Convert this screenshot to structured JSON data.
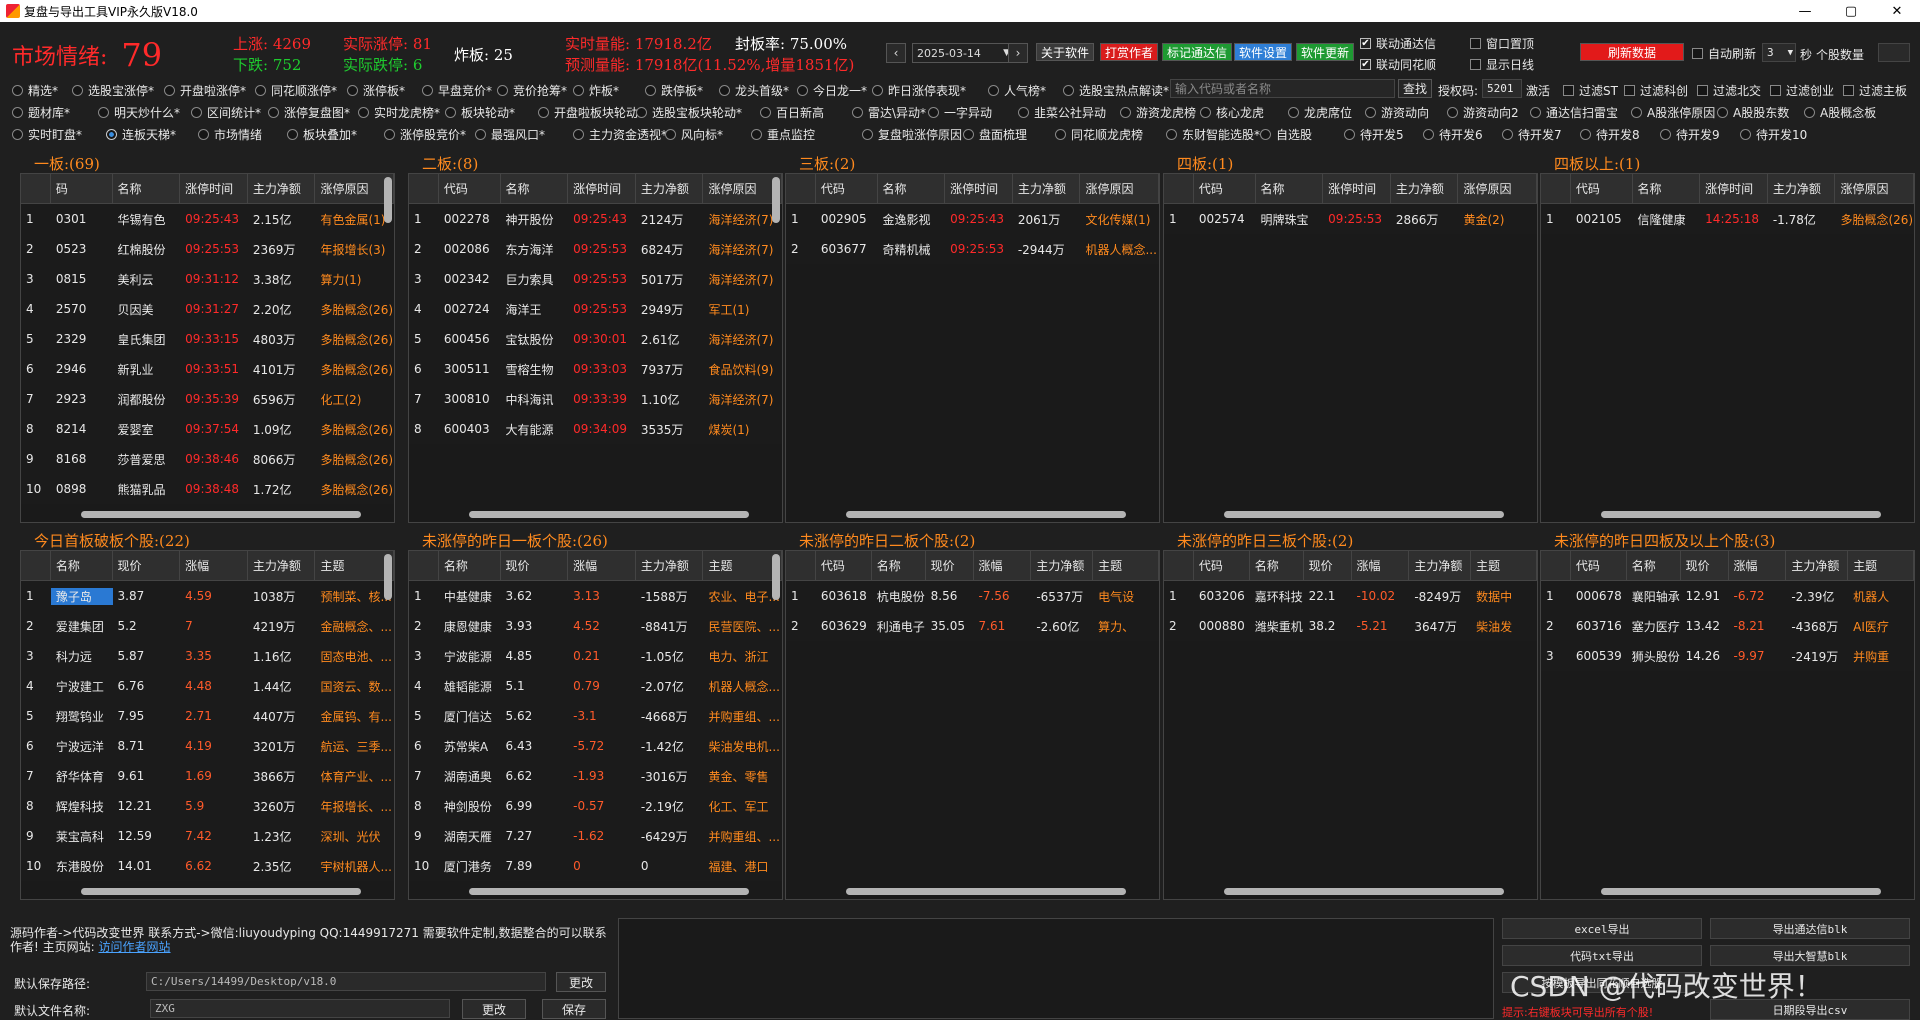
{
  "window": {
    "title": "复盘与导出工具VIP永久版V18.0",
    "min": "—",
    "max": "▢",
    "close": "✕"
  },
  "sentiment": {
    "label": "市场情绪:",
    "value": "79"
  },
  "stats": {
    "up": "上涨: 4269",
    "real_up": "实际涨停: 81",
    "down": "下跌: 752",
    "real_down": "实际跌停: 6",
    "zb": "炸板: 25",
    "vol": "实时量能: 17918.2亿",
    "fbl": "封板率: 75.00%",
    "pred": "预测量能: 17918亿(11.52%,增量1851亿)"
  },
  "toolbar": {
    "date": "2025-03-14",
    "about": "关于软件",
    "tip": "打赏作者",
    "mark": "标记通达信",
    "settings": "软件设置",
    "update": "软件更新",
    "link_tdx": "联动通达信",
    "link_ths": "联动同花顺",
    "win_top": "窗口置顶",
    "show_day": "显示日线",
    "refresh": "刷新数据",
    "auto_refresh": "自动刷新",
    "interval": "3",
    "sec": "秒",
    "stock_count": "个股数量"
  },
  "filters_row1": [
    "精选*",
    "选股宝涨停*",
    "开盘啦涨停*",
    "同花顺涨停*",
    "涨停板*",
    "早盘竞价*",
    "竞价抢筹*",
    "炸板*",
    "跌停板*",
    "龙头首级*",
    "今日龙一*",
    "昨日涨停表现*",
    "人气榜*",
    "选股宝热点解读*"
  ],
  "search": {
    "placeholder": "输入代码或者名称",
    "btn": "查找",
    "auth_label": "授权码:",
    "auth": "5201",
    "activate": "激活",
    "f_st": "过滤ST",
    "f_kc": "过滤科创",
    "f_bj": "过滤北交",
    "f_cy": "过滤创业",
    "f_zb": "过滤主板"
  },
  "filters_row2": [
    "题材库*",
    "明天炒什么*",
    "区间统计*",
    "涨停复盘图*",
    "实时龙虎榜*",
    "板块轮动*",
    "开盘啦板块轮动*",
    "选股宝板块轮动*",
    "百日新高",
    "雷达\\异动*",
    "一字异动",
    "韭菜公社异动",
    "游资龙虎榜",
    "核心龙虎",
    "龙虎席位",
    "游资动向",
    "游资动向2",
    "通达信扫雷宝",
    "A股涨停原因",
    "A股股东数",
    "A股概念板"
  ],
  "filters_row3": [
    "实时盯盘*",
    "连板天梯*",
    "市场情绪",
    "板块叠加*",
    "涨停股竞价*",
    "最强风口*",
    "主力资金透视*",
    "风向标*",
    "重点监控",
    "复盘啦涨停原因",
    "盘面梳理",
    "同花顺龙虎榜",
    "东财智能选股*",
    "自选股",
    "待开发5",
    "待开发6",
    "待开发7",
    "待开发8",
    "待开发9",
    "待开发10"
  ],
  "top_panels": [
    {
      "title": "一板:(69)",
      "cols": [
        "码",
        "名称",
        "涨停时间",
        "主力净额",
        "涨停原因"
      ],
      "rows": [
        [
          "1",
          "0301",
          "华锡有色",
          "09:25:43",
          "2.15亿",
          "有色金属(1)"
        ],
        [
          "2",
          "0523",
          "红棉股份",
          "09:25:53",
          "2369万",
          "年报增长(3)"
        ],
        [
          "3",
          "0815",
          "美利云",
          "09:31:12",
          "3.38亿",
          "算力(1)"
        ],
        [
          "4",
          "2570",
          "贝因美",
          "09:31:27",
          "2.20亿",
          "多胎概念(26)"
        ],
        [
          "5",
          "2329",
          "皇氏集团",
          "09:33:15",
          "4803万",
          "多胎概念(26)"
        ],
        [
          "6",
          "2946",
          "新乳业",
          "09:33:51",
          "4101万",
          "多胎概念(26)"
        ],
        [
          "7",
          "2923",
          "润都股份",
          "09:35:39",
          "6596万",
          "化工(2)"
        ],
        [
          "8",
          "8214",
          "爱婴室",
          "09:37:54",
          "1.09亿",
          "多胎概念(26)"
        ],
        [
          "9",
          "8168",
          "莎普爱思",
          "09:38:46",
          "8066万",
          "多胎概念(26)"
        ],
        [
          "10",
          "0898",
          "熊猫乳品",
          "09:38:48",
          "1.72亿",
          "多胎概念(26)"
        ]
      ]
    },
    {
      "title": "二板:(8)",
      "cols": [
        "代码",
        "名称",
        "涨停时间",
        "主力净额",
        "涨停原因"
      ],
      "rows": [
        [
          "1",
          "002278",
          "神开股份",
          "09:25:43",
          "2124万",
          "海洋经济(7)"
        ],
        [
          "2",
          "002086",
          "东方海洋",
          "09:25:53",
          "6824万",
          "海洋经济(7)"
        ],
        [
          "3",
          "002342",
          "巨力索具",
          "09:25:53",
          "5017万",
          "海洋经济(7)"
        ],
        [
          "4",
          "002724",
          "海洋王",
          "09:25:53",
          "2949万",
          "军工(1)"
        ],
        [
          "5",
          "600456",
          "宝钛股份",
          "09:30:01",
          "2.61亿",
          "海洋经济(7)"
        ],
        [
          "6",
          "300511",
          "雪榕生物",
          "09:33:03",
          "7937万",
          "食品饮料(9)"
        ],
        [
          "7",
          "300810",
          "中科海讯",
          "09:33:39",
          "1.10亿",
          "海洋经济(7)"
        ],
        [
          "8",
          "600403",
          "大有能源",
          "09:34:09",
          "3535万",
          "煤炭(1)"
        ]
      ]
    },
    {
      "title": "三板:(2)",
      "cols": [
        "代码",
        "名称",
        "涨停时间",
        "主力净额",
        "涨停原因"
      ],
      "rows": [
        [
          "1",
          "002905",
          "金逸影视",
          "09:25:43",
          "2061万",
          "文化传媒(1)"
        ],
        [
          "2",
          "603677",
          "奇精机械",
          "09:25:53",
          "-2944万",
          "机器人概念..."
        ]
      ]
    },
    {
      "title": "四板:(1)",
      "cols": [
        "代码",
        "名称",
        "涨停时间",
        "主力净额",
        "涨停原因"
      ],
      "rows": [
        [
          "1",
          "002574",
          "明牌珠宝",
          "09:25:53",
          "2866万",
          "黄金(2)"
        ]
      ]
    },
    {
      "title": "四板以上:(1)",
      "cols": [
        "代码",
        "名称",
        "涨停时间",
        "主力净额",
        "涨停原因"
      ],
      "rows": [
        [
          "1",
          "002105",
          "信隆健康",
          "14:25:18",
          "-1.78亿",
          "多胎概念(26)"
        ]
      ]
    }
  ],
  "bottom_panels": [
    {
      "title": "今日首板破板个股:(22)",
      "cols": [
        "名称",
        "现价",
        "涨幅",
        "主力净额",
        "主题"
      ],
      "rows": [
        [
          "1",
          "豫子岛",
          "3.87",
          "4.59",
          "1038万",
          "预制菜、核..."
        ],
        [
          "2",
          "爱建集团",
          "5.2",
          "7",
          "4219万",
          "金融概念、..."
        ],
        [
          "3",
          "科力远",
          "5.87",
          "3.35",
          "1.16亿",
          "固态电池、..."
        ],
        [
          "4",
          "宁波建工",
          "6.76",
          "4.48",
          "1.44亿",
          "国资云、数..."
        ],
        [
          "5",
          "翔鹭钨业",
          "7.95",
          "2.71",
          "4407万",
          "金属钨、有..."
        ],
        [
          "6",
          "宁波远洋",
          "8.71",
          "4.19",
          "3201万",
          "航运、三季..."
        ],
        [
          "7",
          "舒华体育",
          "9.61",
          "1.69",
          "3866万",
          "体育产业、..."
        ],
        [
          "8",
          "辉煌科技",
          "12.21",
          "5.9",
          "3260万",
          "年报增长、..."
        ],
        [
          "9",
          "莱宝高科",
          "12.59",
          "7.42",
          "1.23亿",
          "深圳、光伏"
        ],
        [
          "10",
          "东港股份",
          "14.01",
          "6.62",
          "2.35亿",
          "宇树机器人..."
        ]
      ]
    },
    {
      "title": "未涨停的昨日一板个股:(26)",
      "cols": [
        "名称",
        "现价",
        "涨幅",
        "主力净额",
        "主题"
      ],
      "rows": [
        [
          "1",
          "中基健康",
          "3.62",
          "3.13",
          "-1588万",
          "农业、电子..."
        ],
        [
          "2",
          "康恩健康",
          "3.93",
          "4.52",
          "-8841万",
          "民营医院、..."
        ],
        [
          "3",
          "宁波能源",
          "4.85",
          "0.21",
          "-1.05亿",
          "电力、浙江"
        ],
        [
          "4",
          "雄韬能源",
          "5.1",
          "0.79",
          "-2.07亿",
          "机器人概念..."
        ],
        [
          "5",
          "厦门信达",
          "5.62",
          "-3.1",
          "-4668万",
          "并购重组、..."
        ],
        [
          "6",
          "苏常柴A",
          "6.43",
          "-5.72",
          "-1.42亿",
          "柴油发电机..."
        ],
        [
          "7",
          "湖南通奥",
          "6.62",
          "-1.93",
          "-3016万",
          "黄金、零售"
        ],
        [
          "8",
          "神剑股份",
          "6.99",
          "-0.57",
          "-2.19亿",
          "化工、军工"
        ],
        [
          "9",
          "湖南天雁",
          "7.27",
          "-1.62",
          "-6429万",
          "并购重组、..."
        ],
        [
          "10",
          "厦门港务",
          "7.89",
          "0",
          "0",
          "福建、港口"
        ]
      ]
    },
    {
      "title": "未涨停的昨日二板个股:(2)",
      "cols": [
        "代码",
        "名称",
        "现价",
        "涨幅",
        "主力净额",
        "主题"
      ],
      "rows": [
        [
          "1",
          "603618",
          "杭电股份",
          "8.56",
          "-7.56",
          "-6537万",
          "电气设"
        ],
        [
          "2",
          "603629",
          "利通电子",
          "35.05",
          "7.61",
          "-2.60亿",
          "算力、"
        ]
      ]
    },
    {
      "title": "未涨停的昨日三板个股:(2)",
      "cols": [
        "代码",
        "名称",
        "现价",
        "涨幅",
        "主力净额",
        "主题"
      ],
      "rows": [
        [
          "1",
          "603206",
          "嘉环科技",
          "22.1",
          "-10.02",
          "-8249万",
          "数据中"
        ],
        [
          "2",
          "000880",
          "潍柴重机",
          "38.2",
          "-5.21",
          "3647万",
          "柴油发"
        ]
      ]
    },
    {
      "title": "未涨停的昨日四板及以上个股:(3)",
      "cols": [
        "代码",
        "名称",
        "现价",
        "涨幅",
        "主力净额",
        "主题"
      ],
      "rows": [
        [
          "1",
          "000678",
          "襄阳轴承",
          "12.91",
          "-6.72",
          "-2.39亿",
          "机器人"
        ],
        [
          "2",
          "603716",
          "塞力医疗",
          "13.42",
          "-8.21",
          "-4368万",
          "AI医疗"
        ],
        [
          "3",
          "600539",
          "狮头股份",
          "14.26",
          "-9.97",
          "-2419万",
          "并购重"
        ]
      ]
    }
  ],
  "footer": {
    "author_line": "源码作者->代码改变世界 联系方式->微信:liuyoudyping QQ:1449917271 需要软件定制,数据整合的可以联系作者! 主页网站:",
    "link": "访问作者网站",
    "save_path_label": "默认保存路径:",
    "save_path": "C:/Users/14499/Desktop/v18.0",
    "change1": "更改",
    "file_name_label": "默认文件名称:",
    "file_name": "ZXG",
    "change2": "更改",
    "save": "保存"
  },
  "exports": {
    "excel": "excel导出",
    "tdx": "导出通达信blk",
    "txt": "代码txt导出",
    "dzh": "导出大智慧blk",
    "ths": "按模板导出同花顺自选股",
    "csv_day": "日期段导出csv",
    "hint": "提示:右键板块可导出所有个股!",
    "watermark": "CSDN @代码改变世界！"
  }
}
